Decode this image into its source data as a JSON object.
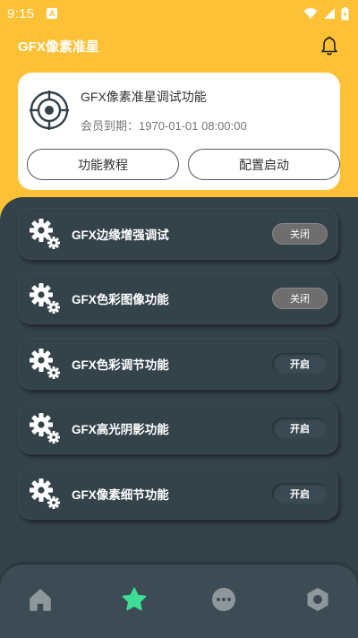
{
  "status": {
    "time": "9:15",
    "app_icon_letter": "A"
  },
  "header": {
    "title": "GFX像素准星"
  },
  "info_card": {
    "title": "GFX像素准星调试功能",
    "membership": "会员到期：1970-01-01 08:00:00",
    "tutorial_button": "功能教程",
    "launch_button": "配置启动"
  },
  "features": [
    {
      "label": "GFX边缘增强调试",
      "toggle": "关闭",
      "state": "off"
    },
    {
      "label": "GFX色彩图像功能",
      "toggle": "关闭",
      "state": "off"
    },
    {
      "label": "GFX色彩调节功能",
      "toggle": "开启",
      "state": "on"
    },
    {
      "label": "GFX高光阴影功能",
      "toggle": "开启",
      "state": "on"
    },
    {
      "label": "GFX像素细节功能",
      "toggle": "开启",
      "state": "on"
    }
  ],
  "nav": {
    "items": [
      "home-icon",
      "star-icon",
      "chat-more-icon",
      "hexagon-settings-icon"
    ],
    "active_index": 1,
    "active_color": "#3DDC97",
    "inactive_color": "#8E979C"
  },
  "colors": {
    "accent": "#FDC137",
    "panel": "#34424A"
  }
}
